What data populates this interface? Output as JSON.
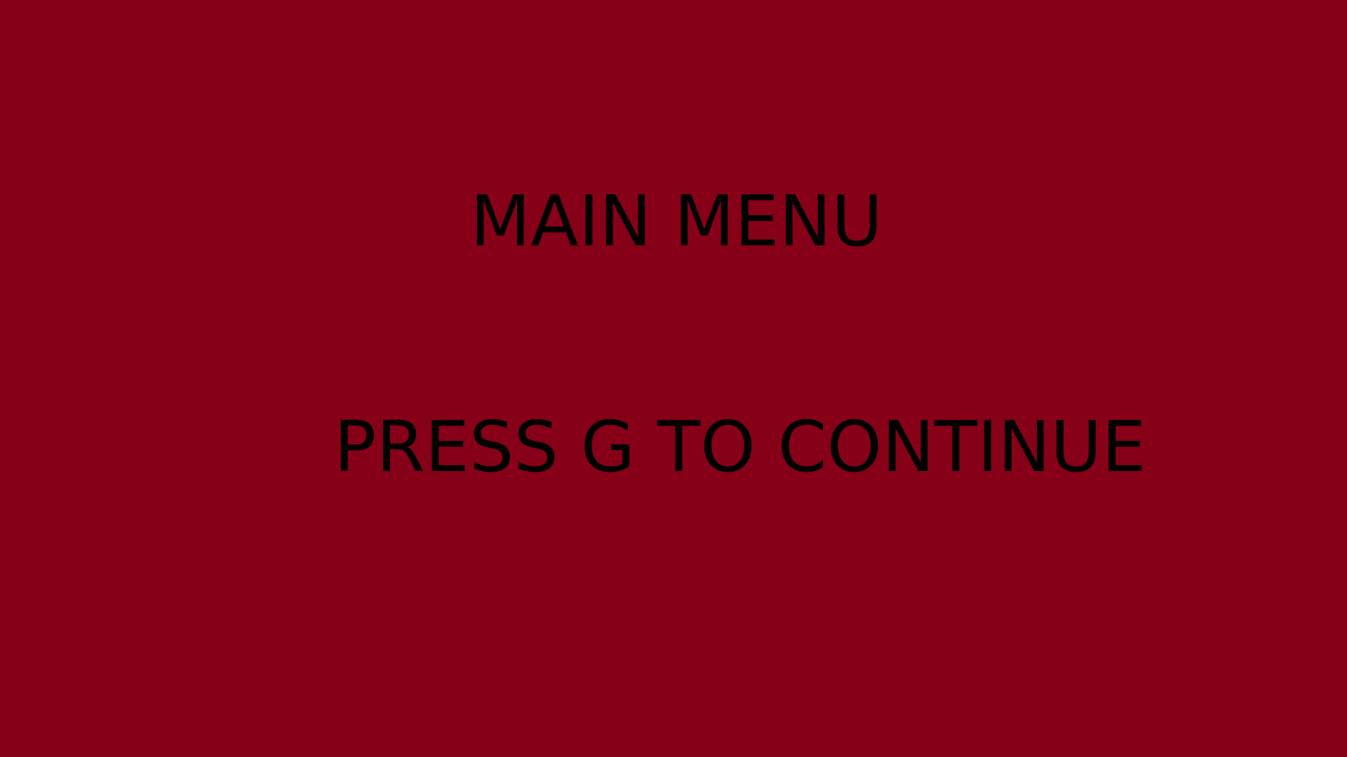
{
  "screen": {
    "background_color": "#860017",
    "text_color": "#000000",
    "title": "MAIN MENU",
    "prompt": "PRESS G TO CONTINUE"
  }
}
